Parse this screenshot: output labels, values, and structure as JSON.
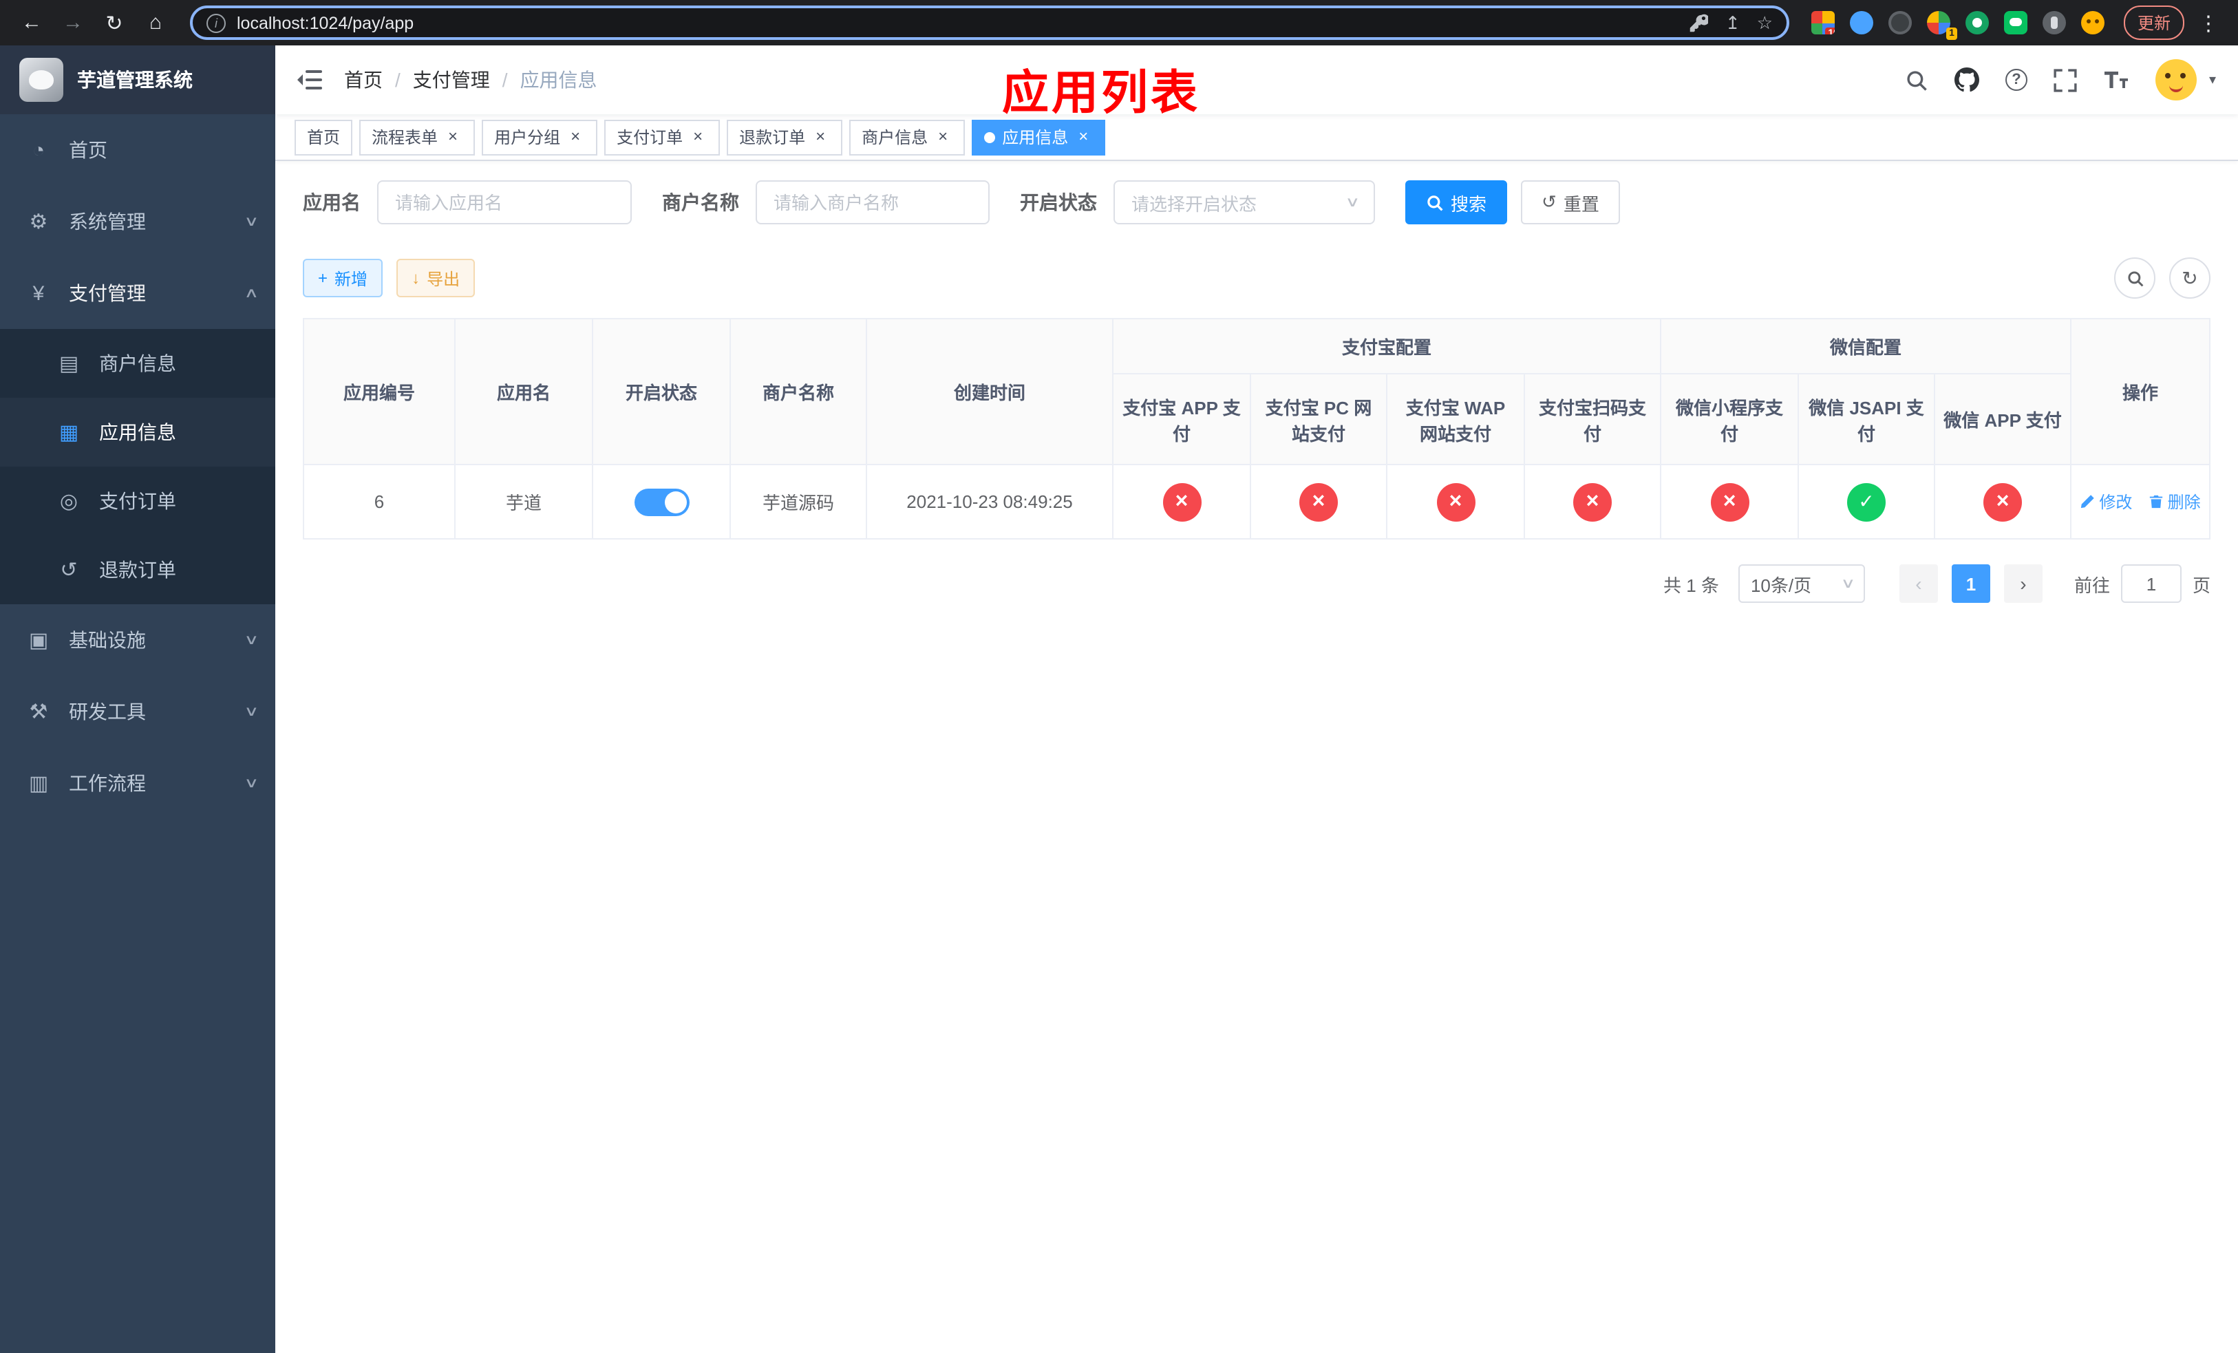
{
  "browser": {
    "url": "localhost:1024/pay/app",
    "update_button": "更新",
    "badge_extensions": "10",
    "badge_profile": "1"
  },
  "icons": {
    "back": "←",
    "forward": "→",
    "reload": "↻",
    "home": "⌂",
    "info": "i",
    "share": "↥",
    "star": "☆",
    "more": "⋮",
    "dashboard": "◔",
    "system": "⚙",
    "payment": "¥",
    "merchant": "▤",
    "app": "▦",
    "order": "◎",
    "refund": "↺",
    "infra": "▣",
    "devtools": "⚒",
    "workflow": "▥",
    "caret_down": "∨",
    "caret_up": "∧",
    "caret_small": "▾",
    "close": "×",
    "question": "?",
    "plus": "+",
    "download": "↓",
    "reset": "↺",
    "refresh": "↻",
    "check": "✓",
    "cross": "×",
    "prev": "‹",
    "next": "›"
  },
  "sidebar": {
    "title": "芋道管理系统",
    "menu": [
      {
        "label": "首页"
      },
      {
        "label": "系统管理"
      },
      {
        "label": "支付管理"
      },
      {
        "label": "基础设施"
      },
      {
        "label": "研发工具"
      },
      {
        "label": "工作流程"
      }
    ],
    "submenu_pay": [
      {
        "label": "商户信息"
      },
      {
        "label": "应用信息"
      },
      {
        "label": "支付订单"
      },
      {
        "label": "退款订单"
      }
    ]
  },
  "navbar": {
    "breadcrumb": [
      "首页",
      "支付管理",
      "应用信息"
    ],
    "separator": "/",
    "overlay_title": "应用列表"
  },
  "tabs": [
    {
      "label": "首页"
    },
    {
      "label": "流程表单"
    },
    {
      "label": "用户分组"
    },
    {
      "label": "支付订单"
    },
    {
      "label": "退款订单"
    },
    {
      "label": "商户信息"
    },
    {
      "label": "应用信息"
    }
  ],
  "filters": {
    "app_name_label": "应用名",
    "app_name_placeholder": "请输入应用名",
    "merchant_label": "商户名称",
    "merchant_placeholder": "请输入商户名称",
    "status_label": "开启状态",
    "status_placeholder": "请选择开启状态",
    "search_button": "搜索",
    "reset_button": "重置"
  },
  "toolbar": {
    "add_button": "新增",
    "export_button": "导出"
  },
  "table": {
    "group_alipay": "支付宝配置",
    "group_wechat": "微信配置",
    "headers": {
      "id": "应用编号",
      "name": "应用名",
      "status": "开启状态",
      "merchant": "商户名称",
      "created": "创建时间",
      "alipay_app": "支付宝 APP 支付",
      "alipay_pc": "支付宝 PC 网站支付",
      "alipay_wap": "支付宝 WAP 网站支付",
      "alipay_qr": "支付宝扫码支付",
      "wx_mini": "微信小程序支付",
      "wx_jsapi": "微信 JSAPI 支付",
      "wx_app": "微信 APP 支付",
      "actions": "操作"
    },
    "row": {
      "id": "6",
      "name": "芋道",
      "status_on": true,
      "merchant": "芋道源码",
      "created": "2021-10-23 08:49:25",
      "configs": [
        "off",
        "off",
        "off",
        "off",
        "off",
        "on",
        "off"
      ],
      "edit": "修改",
      "delete": "删除"
    }
  },
  "pagination": {
    "total": "共 1 条",
    "page_size": "10条/页",
    "page": "1",
    "goto_label": "前往",
    "goto_value": "1",
    "goto_suffix": "页"
  }
}
